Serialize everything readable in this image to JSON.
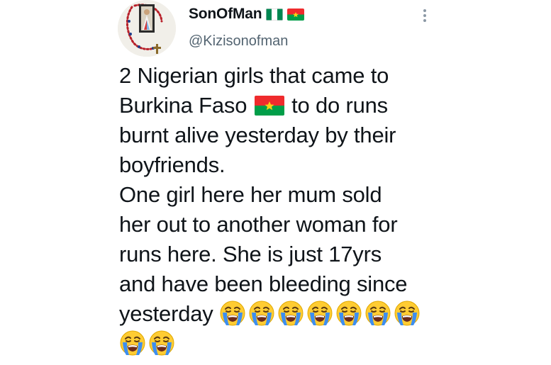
{
  "author": {
    "display_name": "SonOfMan",
    "handle": "@Kizisonofman",
    "flags": [
      "nigeria-flag",
      "burkina-faso-flag"
    ]
  },
  "tweet": {
    "lines": [
      "2 Nigerian girls that came to",
      "Burkina Faso",
      "to do runs",
      "burnt alive yesterday by their",
      "boyfriends.",
      "One girl here her mum sold",
      "her out to another woman for",
      "runs here. She is just 17yrs",
      "and have been bleeding since",
      "yesterday"
    ],
    "emoji": "crying-face",
    "emoji_count_line1": 7,
    "emoji_count_line2": 2
  },
  "colors": {
    "text": "#0f1419",
    "secondary": "#536471",
    "nigeria_green": "#008751",
    "burkina_red": "#ef2b2d",
    "burkina_green": "#009e49",
    "burkina_star": "#fcd116"
  }
}
